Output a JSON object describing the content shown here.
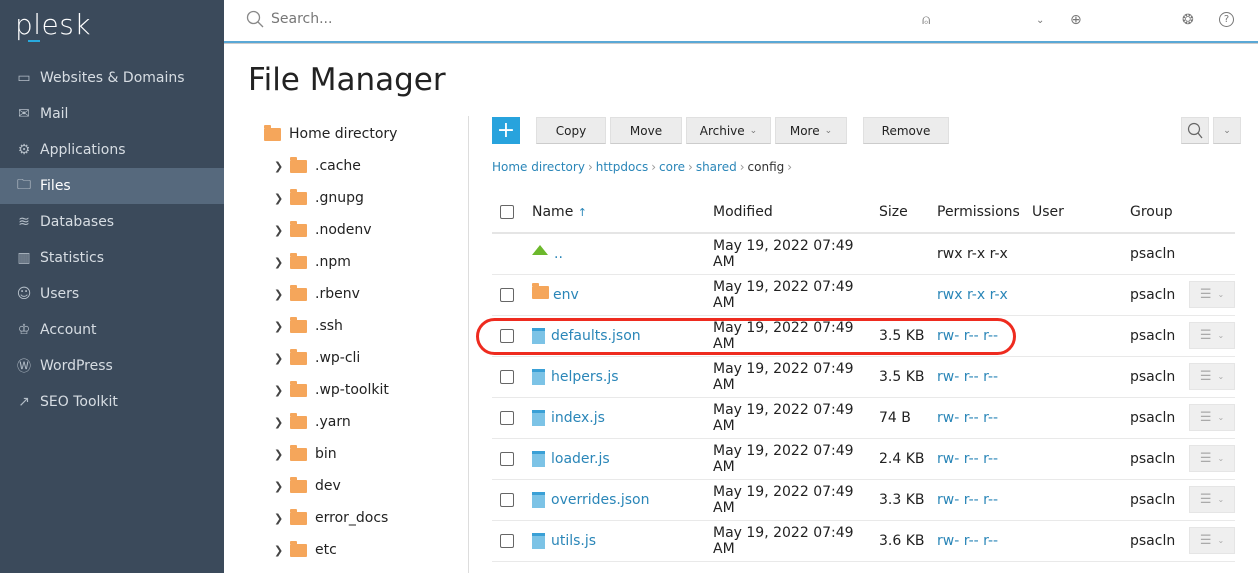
{
  "app": {
    "logo": "plesk"
  },
  "sidebar": {
    "items": [
      {
        "label": "Websites & Domains",
        "icon": "monitor-icon",
        "glyph": "▭"
      },
      {
        "label": "Mail",
        "icon": "mail-icon",
        "glyph": "✉"
      },
      {
        "label": "Applications",
        "icon": "gear-icon",
        "glyph": "⚙"
      },
      {
        "label": "Files",
        "icon": "folder-icon",
        "glyph": "🗀",
        "active": true
      },
      {
        "label": "Databases",
        "icon": "database-icon",
        "glyph": "≋"
      },
      {
        "label": "Statistics",
        "icon": "bar-chart-icon",
        "glyph": "▥"
      },
      {
        "label": "Users",
        "icon": "user-icon",
        "glyph": "☺"
      },
      {
        "label": "Account",
        "icon": "crown-icon",
        "glyph": "♔"
      },
      {
        "label": "WordPress",
        "icon": "wordpress-icon",
        "glyph": "Ⓦ"
      },
      {
        "label": "SEO Toolkit",
        "icon": "chart-line-icon",
        "glyph": "↗"
      }
    ]
  },
  "header": {
    "search_placeholder": "Search..."
  },
  "page": {
    "title": "File Manager"
  },
  "tree": {
    "root": "Home directory",
    "items": [
      ".cache",
      ".gnupg",
      ".nodenv",
      ".npm",
      ".rbenv",
      ".ssh",
      ".wp-cli",
      ".wp-toolkit",
      ".yarn",
      "bin",
      "dev",
      "error_docs",
      "etc"
    ]
  },
  "toolbar": {
    "add": "+",
    "copy": "Copy",
    "move": "Move",
    "archive": "Archive",
    "more": "More",
    "remove": "Remove"
  },
  "breadcrumb": [
    "Home directory",
    "httpdocs",
    "core",
    "shared"
  ],
  "breadcrumb_current": "config",
  "table": {
    "headers": {
      "name": "Name",
      "sort": "↑",
      "modified": "Modified",
      "size": "Size",
      "permissions": "Permissions",
      "user": "User",
      "group": "Group"
    },
    "rows": [
      {
        "name": "..",
        "type": "up",
        "modified": "May 19, 2022 07:49 AM",
        "size": "",
        "permissions": "rwx r-x r-x",
        "group": "psacln"
      },
      {
        "name": "env",
        "type": "folder",
        "modified": "May 19, 2022 07:49 AM",
        "size": "",
        "permissions": "rwx r-x r-x",
        "group": "psacln"
      },
      {
        "name": "defaults.json",
        "type": "file",
        "modified": "May 19, 2022 07:49 AM",
        "size": "3.5 KB",
        "permissions": "rw- r-- r--",
        "group": "psacln",
        "highlighted": true
      },
      {
        "name": "helpers.js",
        "type": "file",
        "modified": "May 19, 2022 07:49 AM",
        "size": "3.5 KB",
        "permissions": "rw- r-- r--",
        "group": "psacln"
      },
      {
        "name": "index.js",
        "type": "file",
        "modified": "May 19, 2022 07:49 AM",
        "size": "74 B",
        "permissions": "rw- r-- r--",
        "group": "psacln"
      },
      {
        "name": "loader.js",
        "type": "file",
        "modified": "May 19, 2022 07:49 AM",
        "size": "2.4 KB",
        "permissions": "rw- r-- r--",
        "group": "psacln"
      },
      {
        "name": "overrides.json",
        "type": "file",
        "modified": "May 19, 2022 07:49 AM",
        "size": "3.3 KB",
        "permissions": "rw- r-- r--",
        "group": "psacln"
      },
      {
        "name": "utils.js",
        "type": "file",
        "modified": "May 19, 2022 07:49 AM",
        "size": "3.6 KB",
        "permissions": "rw- r-- r--",
        "group": "psacln"
      }
    ]
  },
  "colors": {
    "sidebar": "#3b4a5b",
    "sidebar_active": "#56697d",
    "accent": "#28a3dd",
    "link": "#2a86b8",
    "highlight": "#ee2b1f"
  }
}
